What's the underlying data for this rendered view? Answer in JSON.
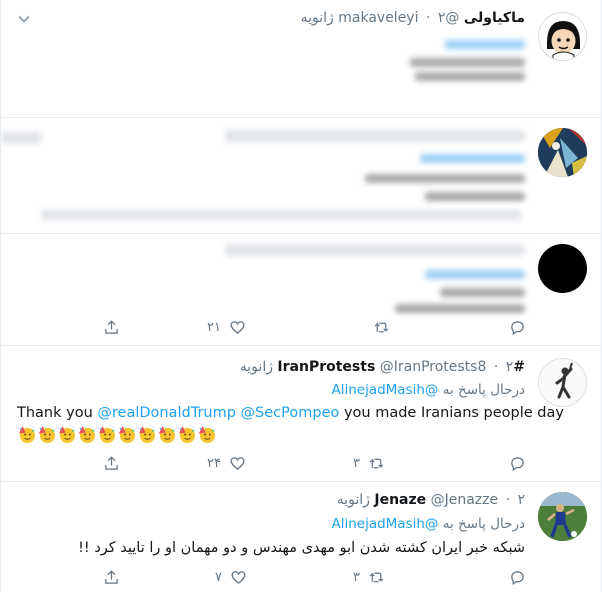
{
  "tweets": [
    {
      "name": "ماکیاولی",
      "handle": "@makaveleyi",
      "time": "۲ ژانویه",
      "blurred": true
    },
    {
      "blurred": true
    },
    {
      "blurred": true,
      "actions": {
        "reply": "",
        "retweet": "",
        "like": "۲۱",
        "share": ""
      }
    },
    {
      "name": "#IranProtests",
      "handle": "@IranProtests8",
      "time": "۲ ژانویه",
      "reply_prefix": "درحال پاسخ به",
      "reply_to": "@AlinejadMasih",
      "text_before": "Thank you ",
      "mention1": "@realDonaldTrump",
      "mention2": "@SecPompeo",
      "text_after": " you made Iranians people day",
      "emoji_name": "party-face-icon",
      "emoji_count": 10,
      "actions": {
        "reply": "",
        "retweet": "۳",
        "like": "۲۴",
        "share": ""
      }
    },
    {
      "name": "Jenaze",
      "handle": "@Jenazze",
      "time": "۲ ژانویه",
      "reply_prefix": "درحال پاسخ به",
      "reply_to": "@AlinejadMasih",
      "text": "شبکه خبر ایران کشته شدن ابو مهدی مهندس و دو مهمان او را تایید کرد !!",
      "actions": {
        "reply": "",
        "retweet": "۳",
        "like": "۷",
        "share": ""
      }
    }
  ],
  "colors": {
    "accent": "#1da1f2",
    "muted": "#657786",
    "border": "#e6ecf0"
  }
}
